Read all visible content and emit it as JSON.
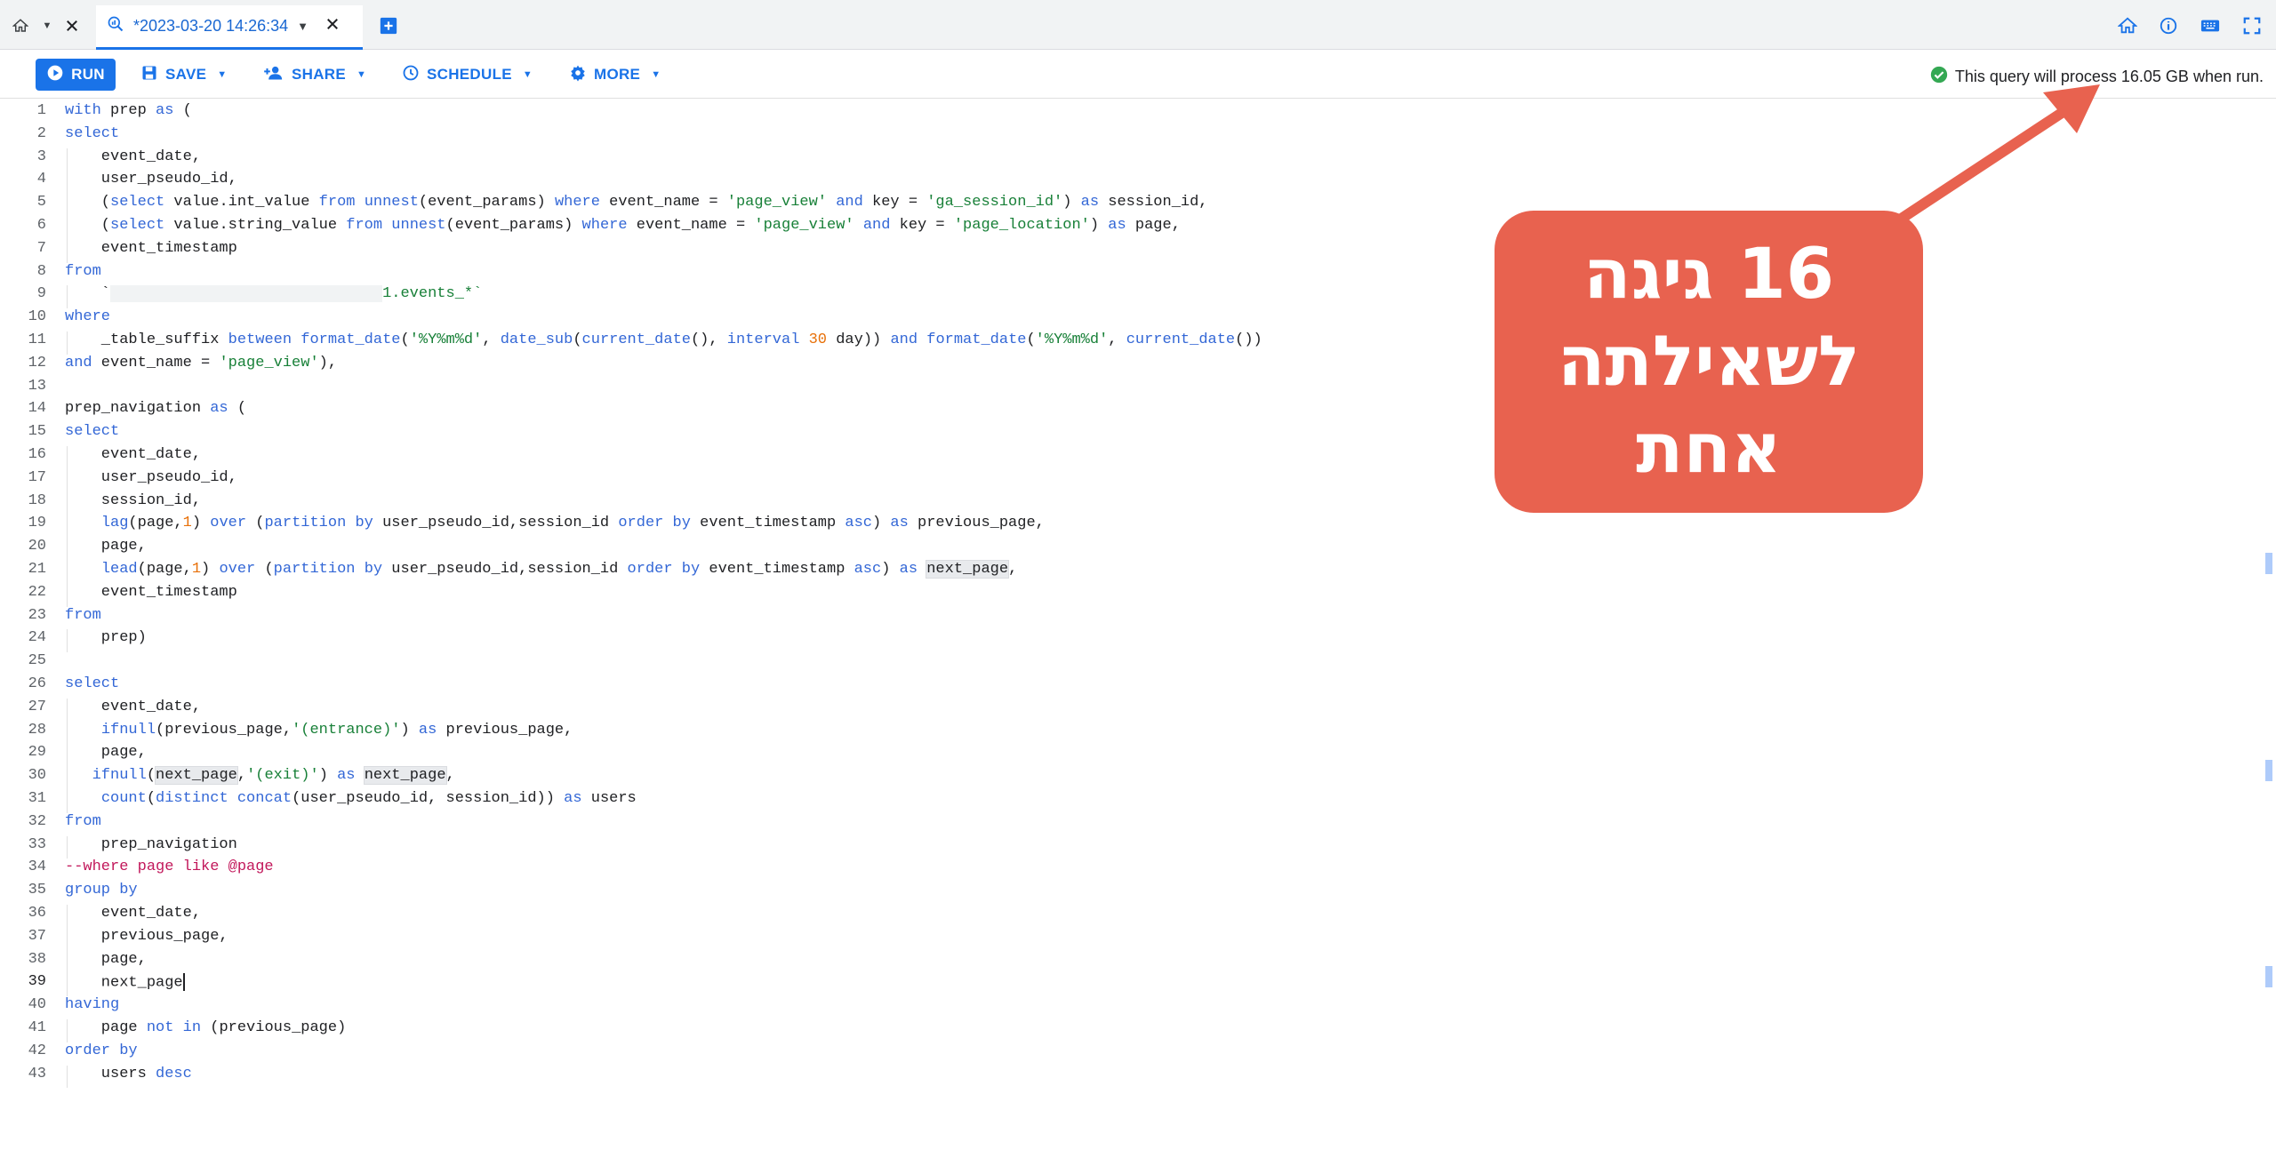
{
  "tabbar": {
    "home_icon": "home-icon",
    "tab_title": "*2023-03-20 14:26:34",
    "tab_icon": "query-icon",
    "add_tab_icon": "add-tab-icon",
    "right_icons": [
      "home-icon",
      "info-icon",
      "keyboard-icon",
      "fullscreen-icon"
    ]
  },
  "toolbar": {
    "run_label": "RUN",
    "save_label": "SAVE",
    "share_label": "SHARE",
    "schedule_label": "SCHEDULE",
    "more_label": "MORE",
    "status_text": "This query will process 16.05 GB when run.",
    "status_color": "#34a853",
    "accent_color": "#1a73e8"
  },
  "editor": {
    "active_line": 39,
    "lines": [
      [
        [
          "with ",
          "kw"
        ],
        [
          "prep ",
          ""
        ],
        [
          "as",
          "kw"
        ],
        [
          " (",
          ""
        ]
      ],
      [
        [
          "select",
          "kw"
        ]
      ],
      [
        [
          "    event_date,",
          ""
        ]
      ],
      [
        [
          "    user_pseudo_id,",
          ""
        ]
      ],
      [
        [
          "    (",
          ""
        ],
        [
          "select",
          "kw"
        ],
        [
          " value.int_value ",
          ""
        ],
        [
          "from",
          "kw"
        ],
        [
          " ",
          ""
        ],
        [
          "unnest",
          "kw"
        ],
        [
          "(event_params) ",
          ""
        ],
        [
          "where",
          "kw"
        ],
        [
          " event_name = ",
          ""
        ],
        [
          "'page_view'",
          "str"
        ],
        [
          " ",
          ""
        ],
        [
          "and",
          "kw"
        ],
        [
          " key = ",
          ""
        ],
        [
          "'ga_session_id'",
          "str"
        ],
        [
          ") ",
          ""
        ],
        [
          "as",
          "kw"
        ],
        [
          " session_id,",
          ""
        ]
      ],
      [
        [
          "    (",
          ""
        ],
        [
          "select",
          "kw"
        ],
        [
          " value.string_value ",
          ""
        ],
        [
          "from",
          "kw"
        ],
        [
          " ",
          ""
        ],
        [
          "unnest",
          "kw"
        ],
        [
          "(event_params) ",
          ""
        ],
        [
          "where",
          "kw"
        ],
        [
          " event_name = ",
          ""
        ],
        [
          "'page_view'",
          "str"
        ],
        [
          " ",
          ""
        ],
        [
          "and",
          "kw"
        ],
        [
          " key = ",
          ""
        ],
        [
          "'page_location'",
          "str"
        ],
        [
          ") ",
          ""
        ],
        [
          "as",
          "kw"
        ],
        [
          " page,",
          ""
        ]
      ],
      [
        [
          "    event_timestamp",
          ""
        ]
      ],
      [
        [
          "from",
          "kw"
        ]
      ],
      [
        [
          "    `",
          ""
        ],
        [
          "                              ",
          "redact"
        ],
        [
          "1.events_*`",
          "str"
        ]
      ],
      [
        [
          "where",
          "kw"
        ]
      ],
      [
        [
          "    _table_suffix ",
          ""
        ],
        [
          "between",
          "kw"
        ],
        [
          " ",
          ""
        ],
        [
          "format_date",
          "kw"
        ],
        [
          "(",
          ""
        ],
        [
          "'%Y%m%d'",
          "str"
        ],
        [
          ", ",
          ""
        ],
        [
          "date_sub",
          "kw"
        ],
        [
          "(",
          ""
        ],
        [
          "current_date",
          "kw"
        ],
        [
          "(), ",
          ""
        ],
        [
          "interval",
          "kw"
        ],
        [
          " ",
          ""
        ],
        [
          "30",
          "num"
        ],
        [
          " day)) ",
          ""
        ],
        [
          "and",
          "kw"
        ],
        [
          " ",
          ""
        ],
        [
          "format_date",
          "kw"
        ],
        [
          "(",
          ""
        ],
        [
          "'%Y%m%d'",
          "str"
        ],
        [
          ", ",
          ""
        ],
        [
          "current_date",
          "kw"
        ],
        [
          "())",
          ""
        ]
      ],
      [
        [
          "and",
          "kw"
        ],
        [
          " event_name = ",
          ""
        ],
        [
          "'page_view'",
          "str"
        ],
        [
          "),",
          ""
        ]
      ],
      [
        [
          "",
          ""
        ]
      ],
      [
        [
          "prep_navigation ",
          ""
        ],
        [
          "as",
          "kw"
        ],
        [
          " (",
          ""
        ]
      ],
      [
        [
          "select",
          "kw"
        ]
      ],
      [
        [
          "    event_date,",
          ""
        ]
      ],
      [
        [
          "    user_pseudo_id,",
          ""
        ]
      ],
      [
        [
          "    session_id,",
          ""
        ]
      ],
      [
        [
          "    ",
          ""
        ],
        [
          "lag",
          "kw"
        ],
        [
          "(page,",
          ""
        ],
        [
          "1",
          "num"
        ],
        [
          ") ",
          ""
        ],
        [
          "over",
          "kw"
        ],
        [
          " (",
          ""
        ],
        [
          "partition by",
          "kw"
        ],
        [
          " user_pseudo_id,session_id ",
          ""
        ],
        [
          "order by",
          "kw"
        ],
        [
          " event_timestamp ",
          ""
        ],
        [
          "asc",
          "kw"
        ],
        [
          ") ",
          ""
        ],
        [
          "as",
          "kw"
        ],
        [
          " previous_page,",
          ""
        ]
      ],
      [
        [
          "    page,",
          ""
        ]
      ],
      [
        [
          "    ",
          ""
        ],
        [
          "lead",
          "kw"
        ],
        [
          "(page,",
          ""
        ],
        [
          "1",
          "num"
        ],
        [
          ") ",
          ""
        ],
        [
          "over",
          "kw"
        ],
        [
          " (",
          ""
        ],
        [
          "partition by",
          "kw"
        ],
        [
          " user_pseudo_id,session_id ",
          ""
        ],
        [
          "order by",
          "kw"
        ],
        [
          " event_timestamp ",
          ""
        ],
        [
          "asc",
          "kw"
        ],
        [
          ") ",
          ""
        ],
        [
          "as",
          "kw"
        ],
        [
          " ",
          ""
        ],
        [
          "next_page",
          "hl"
        ],
        [
          ",",
          ""
        ]
      ],
      [
        [
          "    event_timestamp",
          ""
        ]
      ],
      [
        [
          "from",
          "kw"
        ]
      ],
      [
        [
          "    prep)",
          ""
        ]
      ],
      [
        [
          "",
          ""
        ]
      ],
      [
        [
          "select",
          "kw"
        ]
      ],
      [
        [
          "    event_date,",
          ""
        ]
      ],
      [
        [
          "    ",
          ""
        ],
        [
          "ifnull",
          "kw"
        ],
        [
          "(previous_page,",
          ""
        ],
        [
          "'(entrance)'",
          "str"
        ],
        [
          ") ",
          ""
        ],
        [
          "as",
          "kw"
        ],
        [
          " previous_page,",
          ""
        ]
      ],
      [
        [
          "    page,",
          ""
        ]
      ],
      [
        [
          "   ",
          ""
        ],
        [
          "ifnull",
          "kw"
        ],
        [
          "(",
          ""
        ],
        [
          "next_page",
          "hl"
        ],
        [
          ",",
          ""
        ],
        [
          "'(exit)'",
          "str"
        ],
        [
          ") ",
          ""
        ],
        [
          "as",
          "kw"
        ],
        [
          " ",
          ""
        ],
        [
          "next_page",
          "hl"
        ],
        [
          ",",
          ""
        ]
      ],
      [
        [
          "    ",
          ""
        ],
        [
          "count",
          "kw"
        ],
        [
          "(",
          ""
        ],
        [
          "distinct",
          "kw"
        ],
        [
          " ",
          ""
        ],
        [
          "concat",
          "kw"
        ],
        [
          "(user_pseudo_id, session_id)) ",
          ""
        ],
        [
          "as",
          "kw"
        ],
        [
          " users",
          ""
        ]
      ],
      [
        [
          "from",
          "kw"
        ]
      ],
      [
        [
          "    prep_navigation",
          ""
        ]
      ],
      [
        [
          "--where page like @page",
          "com"
        ]
      ],
      [
        [
          "group by",
          "kw"
        ]
      ],
      [
        [
          "    event_date,",
          ""
        ]
      ],
      [
        [
          "    previous_page,",
          ""
        ]
      ],
      [
        [
          "    page,",
          ""
        ]
      ],
      [
        [
          "    next_page",
          ""
        ],
        [
          "",
          "cursor"
        ]
      ],
      [
        [
          "having",
          "kw"
        ]
      ],
      [
        [
          "    page ",
          ""
        ],
        [
          "not in",
          "kw"
        ],
        [
          " (previous_page)",
          ""
        ]
      ],
      [
        [
          "order by",
          "kw"
        ]
      ],
      [
        [
          "    users ",
          ""
        ],
        [
          "desc",
          "kw"
        ]
      ]
    ]
  },
  "annotation": {
    "line1": "16 גיגה",
    "line2": "לשאילתה",
    "line3": "אחת",
    "color": "#e8624f"
  }
}
